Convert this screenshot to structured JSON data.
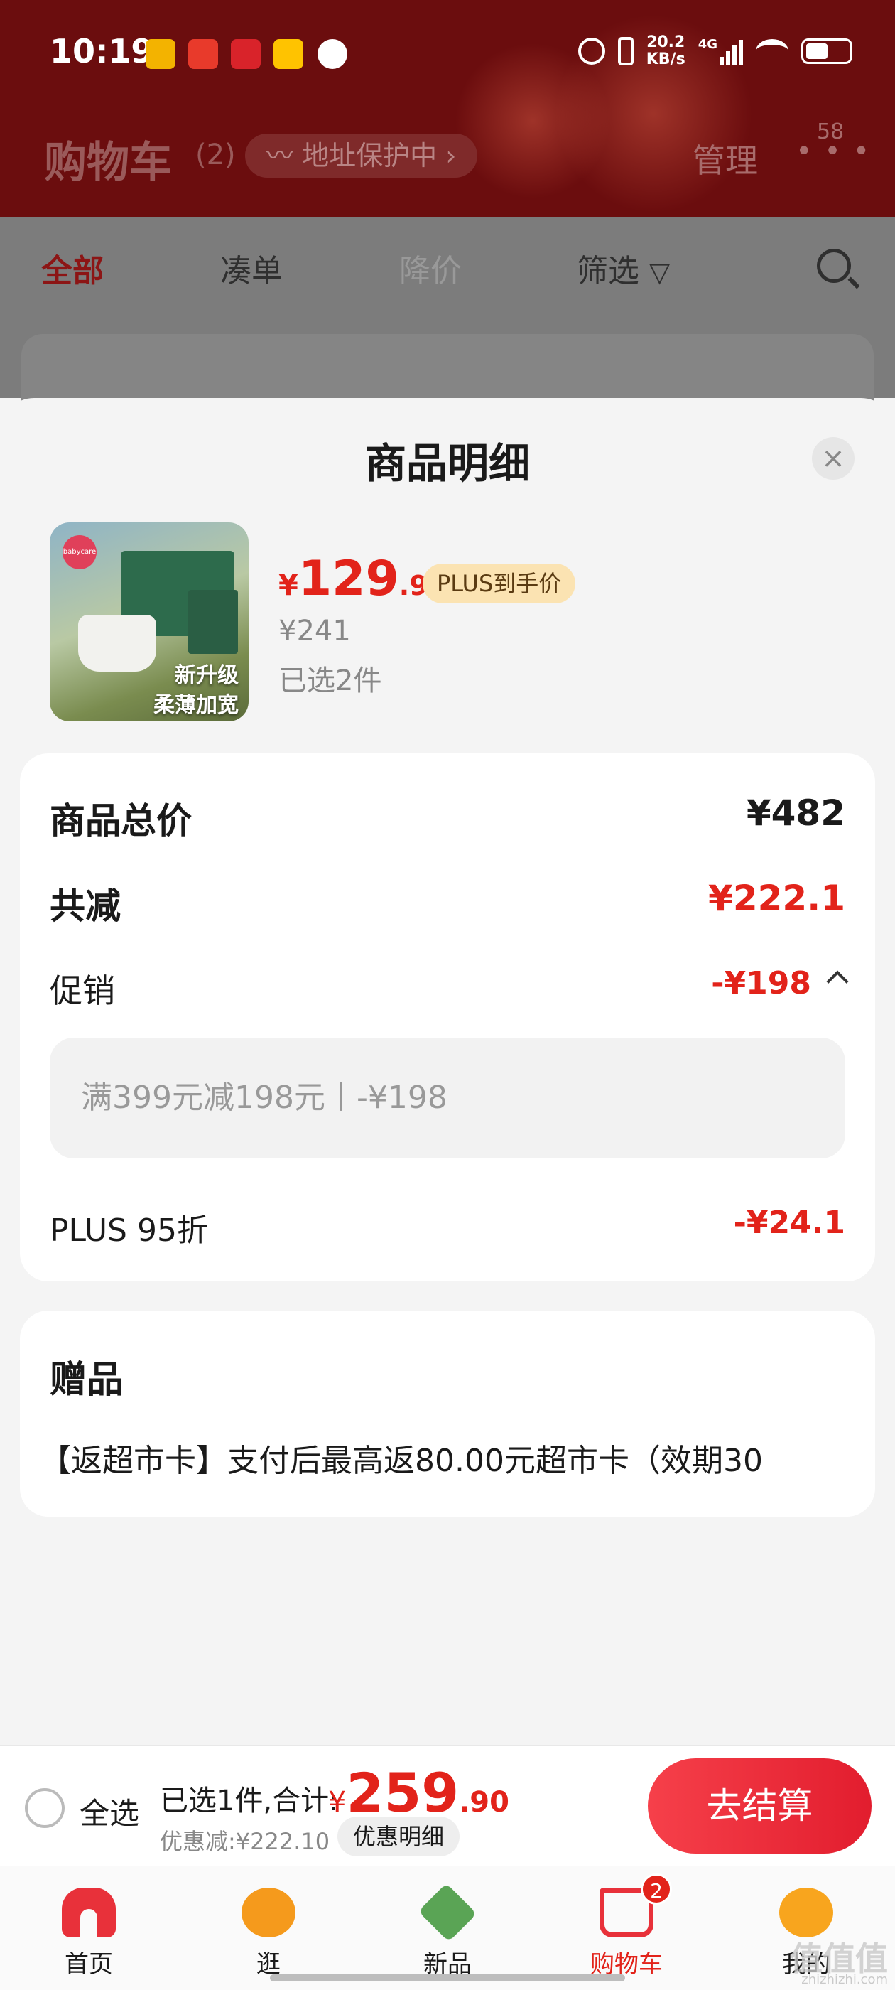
{
  "status_bar": {
    "time": "10:19",
    "network_speed": "20.2",
    "network_unit": "KB/s",
    "network_type": "4G",
    "icons": [
      "alarm-icon",
      "vibrate-icon",
      "signal-icon",
      "wifi-icon",
      "battery-icon"
    ]
  },
  "header": {
    "title": "购物车",
    "count": "(2)",
    "address_label": "地址保护中",
    "manage_label": "管理",
    "more_badge": "58"
  },
  "filter_tabs": [
    {
      "label": "全部"
    },
    {
      "label": "凑单"
    },
    {
      "label": "降价"
    },
    {
      "label": "筛选"
    }
  ],
  "sheet": {
    "title": "商品明细",
    "close_icon": "close-icon",
    "product": {
      "image_caption_1": "新升级",
      "image_caption_2": "柔薄加宽",
      "brand_mark": "babycare",
      "price_symbol": "¥",
      "price_int": "129",
      "price_dec": ".95",
      "plus_tag": "PLUS到手价",
      "original_price": "¥241",
      "selected": "已选2件"
    },
    "summary": {
      "total_label": "商品总价",
      "total_value": "¥482",
      "reduce_label": "共减",
      "reduce_value": "¥222.1",
      "promo_label": "促销",
      "promo_value": "-¥198",
      "promo_detail": "满399元减198元丨-¥198",
      "plus_label": "PLUS 95折",
      "plus_value": "-¥24.1"
    },
    "gift": {
      "title": "赠品",
      "text": "【返超市卡】支付后最高返80.00元超市卡（效期30"
    }
  },
  "checkout": {
    "select_all": "全选",
    "summary_label": "已选1件,合计:",
    "price_symbol": "¥",
    "price_int": "259",
    "price_dec": ".90",
    "discount": "优惠减:¥222.10",
    "discount_detail": "优惠明细",
    "pay_button": "去结算"
  },
  "tabbar": {
    "items": [
      {
        "label": "首页",
        "icon": "home-icon"
      },
      {
        "label": "逛",
        "icon": "browse-icon"
      },
      {
        "label": "新品",
        "icon": "new-products-icon"
      },
      {
        "label": "购物车",
        "icon": "cart-icon",
        "badge": "2"
      },
      {
        "label": "我的",
        "icon": "profile-icon"
      }
    ]
  },
  "watermark": {
    "text": "值值值",
    "sub": "zhizhizhi.com"
  },
  "colors": {
    "brand_red": "#e2231a",
    "header_bg": "#6b0d0e",
    "plus_tag_bg": "#fbe3b2"
  }
}
